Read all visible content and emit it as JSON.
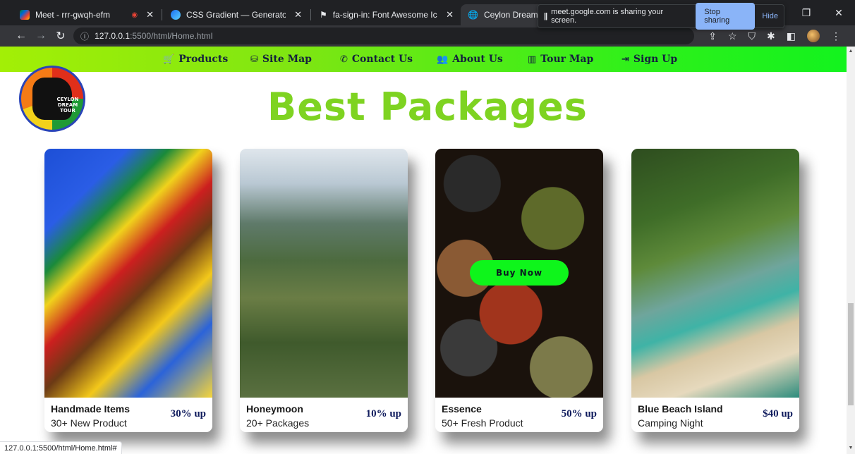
{
  "browser": {
    "tabs": [
      {
        "label": "Meet - rrr-gwqh-efm",
        "favicon": "google-meet-icon"
      },
      {
        "label": "CSS Gradient — Generator, Make",
        "favicon": "css-gradient-icon"
      },
      {
        "label": "fa-sign-in: Font Awesome Icons",
        "favicon": "font-awesome-flag-icon"
      },
      {
        "label": "Ceylon Dream Tou",
        "favicon": "globe-icon"
      }
    ],
    "address": {
      "host": "127.0.0.1",
      "rest": ":5500/html/Home.html"
    },
    "share_banner": {
      "text": "meet.google.com is sharing your screen.",
      "stop_label": "Stop sharing",
      "hide_label": "Hide"
    },
    "status_url": "127.0.0.1:5500/html/Home.html#"
  },
  "nav": {
    "items": [
      {
        "label": "Products",
        "icon": "cart-icon",
        "glyph": "🛒"
      },
      {
        "label": "Site Map",
        "icon": "sitemap-icon",
        "glyph": "⛁"
      },
      {
        "label": "Contact Us",
        "icon": "phone-icon",
        "glyph": "✆"
      },
      {
        "label": "About Us",
        "icon": "users-icon",
        "glyph": "👥"
      },
      {
        "label": "Tour Map",
        "icon": "map-icon",
        "glyph": "▥"
      },
      {
        "label": "Sign Up",
        "icon": "sign-in-icon",
        "glyph": "⇥"
      }
    ]
  },
  "logo": {
    "text": "CEYLON DREAM TOUR"
  },
  "heading": "Best Packages",
  "buy_label": "Buy Now",
  "cards": [
    {
      "title": "Handmade Items",
      "subtitle": "30+ New Product",
      "price": "30% up",
      "image": "masks-image"
    },
    {
      "title": "Honeymoon",
      "subtitle": "20+ Packages",
      "price": "10% up",
      "image": "couple-mountain-image"
    },
    {
      "title": "Essence",
      "subtitle": "50+ Fresh Product",
      "price": "50% up",
      "image": "spices-image"
    },
    {
      "title": "Blue Beach Island",
      "subtitle": "Camping Night",
      "price": "$40 up",
      "image": "beach-island-image"
    }
  ]
}
